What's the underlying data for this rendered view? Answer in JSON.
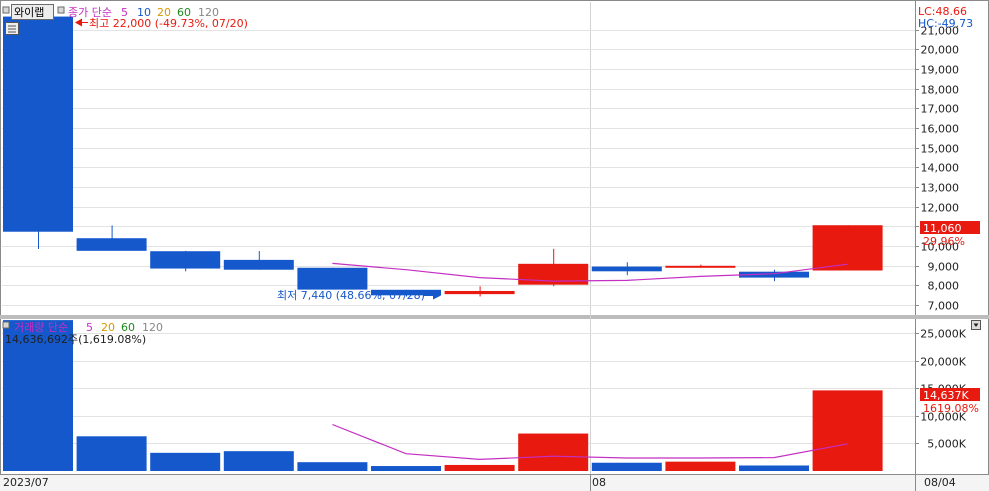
{
  "header": {
    "stock_name": "와이랩",
    "price_legend": {
      "label": "종가 단순",
      "periods": [
        "5",
        "10",
        "20",
        "60",
        "120"
      ]
    },
    "volume_legend": {
      "label": "거래량 단순",
      "periods": [
        "5",
        "20",
        "60",
        "120"
      ]
    },
    "lc_label": "LC:48.66",
    "hc_label": "HC:-49.73"
  },
  "annotations": {
    "high": "최고 22,000 (-49.73%, 07/20)",
    "low": "최저 7,440 (48.66%, 07/28)",
    "volume_info": "14,636,692주(1,619.08%)"
  },
  "badges": {
    "price_value": "11,060",
    "price_pct": "29.96%",
    "volume_value": "14,637K",
    "volume_pct": "1619.08%"
  },
  "x_labels": {
    "start": "2023/07",
    "mid": "08",
    "end": "08/04"
  },
  "colors": {
    "up": "#e8190f",
    "down": "#1458cc",
    "ma": "#c42fc4",
    "label_blue": "#1458cc",
    "label_red": "#e8190f"
  },
  "chart_data": [
    {
      "type": "candlestick",
      "yaxis_labels": [
        "7,000",
        "8,000",
        "9,000",
        "10,000",
        "11,000",
        "12,000",
        "13,000",
        "14,000",
        "15,000",
        "16,000",
        "17,000",
        "18,000",
        "19,000",
        "20,000",
        "21,000"
      ],
      "yaxis_values": [
        7000,
        8000,
        9000,
        10000,
        11000,
        12000,
        13000,
        14000,
        15000,
        16000,
        17000,
        18000,
        19000,
        20000,
        21000
      ],
      "ylim": [
        6500,
        22400
      ],
      "candles": [
        {
          "open": 21660,
          "close": 10730,
          "high": 22000,
          "low": 9850
        },
        {
          "open": 10400,
          "close": 9760,
          "high": 11050,
          "low": 9760
        },
        {
          "open": 9740,
          "close": 8860,
          "high": 9760,
          "low": 8720
        },
        {
          "open": 9300,
          "close": 8800,
          "high": 9750,
          "low": 8800
        },
        {
          "open": 8900,
          "close": 7790,
          "high": 8900,
          "low": 7790
        },
        {
          "open": 7780,
          "close": 7500,
          "high": 7780,
          "low": 7440
        },
        {
          "open": 7560,
          "close": 7720,
          "high": 7960,
          "low": 7440
        },
        {
          "open": 8040,
          "close": 9100,
          "high": 9860,
          "low": 7960
        },
        {
          "open": 8960,
          "close": 8720,
          "high": 9180,
          "low": 8520
        },
        {
          "open": 8940,
          "close": 9000,
          "high": 9060,
          "low": 8900
        },
        {
          "open": 8700,
          "close": 8400,
          "high": 8800,
          "low": 8220
        },
        {
          "open": 8760,
          "close": 11060,
          "high": 11060,
          "low": 8760
        }
      ],
      "ma5": [
        null,
        null,
        null,
        null,
        9120,
        8800,
        8400,
        8220,
        8260,
        8460,
        8600,
        9080
      ]
    },
    {
      "type": "bar",
      "yaxis_labels": [
        "5,000K",
        "10,000K",
        "15,000K",
        "20,000K",
        "25,000K"
      ],
      "yaxis_values": [
        5000,
        10000,
        15000,
        20000,
        25000
      ],
      "ylim": [
        0,
        27600
      ],
      "values": [
        27400,
        6300,
        3300,
        3600,
        1600,
        900,
        1100,
        6800,
        1500,
        1700,
        1000,
        14637
      ],
      "ma5": [
        null,
        null,
        null,
        null,
        8440,
        3140,
        2100,
        2680,
        2360,
        2360,
        2440,
        4940
      ]
    }
  ]
}
